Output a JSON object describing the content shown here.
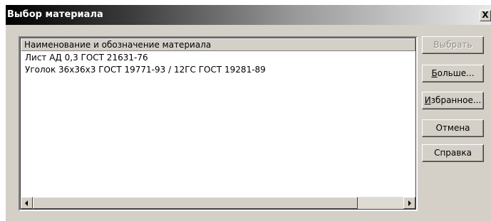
{
  "window": {
    "title": "Выбор материала",
    "close_label": "X"
  },
  "list": {
    "column_header": "Наименование и обозначение материала",
    "rows": [
      "Лист АД 0,3 ГОСТ 21631-76",
      "Уголок 36х36х3 ГОСТ 19771-93 / 12ГС ГОСТ 19281-89"
    ]
  },
  "buttons": {
    "select": {
      "label": "Выбрать",
      "enabled": false
    },
    "more": {
      "mnemonic": "Б",
      "rest": "ольше..."
    },
    "favorites": {
      "mnemonic": "И",
      "rest": "збранное..."
    },
    "cancel": {
      "label": "Отмена"
    },
    "help": {
      "label": "Справка"
    }
  },
  "scrollbar": {
    "horizontal_position": 0
  },
  "colors": {
    "dialog_bg": "#d4d0c8",
    "title_text": "#ffffff",
    "disabled_text": "#8c8a84"
  },
  "icons": {
    "close": "close-icon",
    "scroll_left": "arrow-left-icon",
    "scroll_right": "arrow-right-icon"
  }
}
